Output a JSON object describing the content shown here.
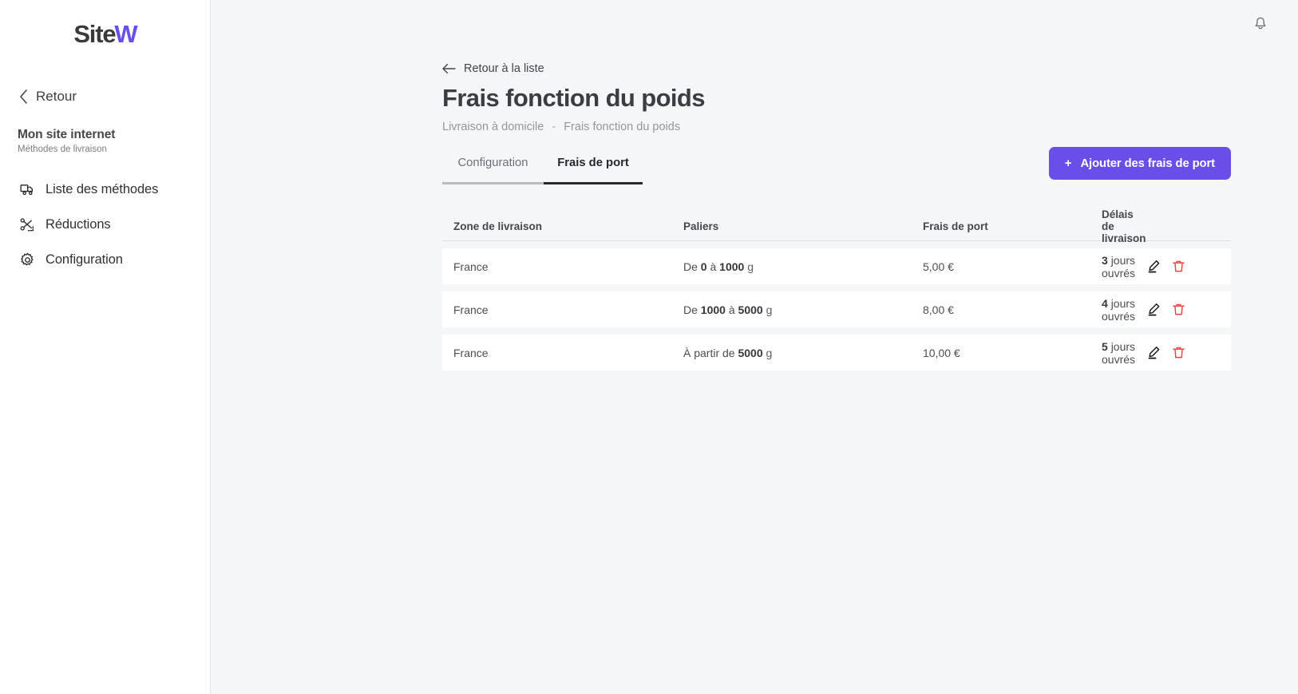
{
  "sidebar": {
    "logo": {
      "text_dark": "Site",
      "text_accent": "W"
    },
    "back": {
      "label": "Retour",
      "icon": "chevron-left-icon"
    },
    "site": {
      "title": "Mon site internet",
      "subtitle": "Méthodes de livraison"
    },
    "items": [
      {
        "label": "Liste des méthodes",
        "icon": "truck-icon"
      },
      {
        "label": "Réductions",
        "icon": "scissors-icon"
      },
      {
        "label": "Configuration",
        "icon": "gear-icon"
      }
    ]
  },
  "topbar": {
    "notification_icon": "bell-icon"
  },
  "header": {
    "back_to_list": "Retour à la liste",
    "back_icon": "arrow-left-icon",
    "title": "Frais fonction du poids",
    "breadcrumb": {
      "parent": "Livraison à domicile",
      "separator": "-",
      "current": "Frais fonction du poids"
    }
  },
  "tabs": [
    {
      "label": "Configuration",
      "active": false
    },
    {
      "label": "Frais de port",
      "active": true
    }
  ],
  "actions": {
    "add_button": {
      "plus": "+",
      "label": "Ajouter des frais de port"
    }
  },
  "table": {
    "headers": [
      "Zone de livraison",
      "Paliers",
      "Frais de port",
      "Délais de livraison"
    ],
    "row_icons": {
      "edit": "pencil-icon",
      "delete": "trash-icon"
    },
    "rows": [
      {
        "zone": "France",
        "palier_prefix": "De",
        "palier_from": "0",
        "palier_mid": "à",
        "palier_to": "1000",
        "palier_unit": "g",
        "price": "5,00 €",
        "delay_number": "3",
        "delay_text": "jours ouvrés"
      },
      {
        "zone": "France",
        "palier_prefix": "De",
        "palier_from": "1000",
        "palier_mid": "à",
        "palier_to": "5000",
        "palier_unit": "g",
        "price": "8,00 €",
        "delay_number": "4",
        "delay_text": "jours ouvrés"
      },
      {
        "zone": "France",
        "palier_prefix": "À partir de",
        "palier_from": "",
        "palier_mid": "",
        "palier_to": "5000",
        "palier_unit": "g",
        "price": "10,00 €",
        "delay_number": "5",
        "delay_text": "jours ouvrés"
      }
    ]
  },
  "colors": {
    "accent": "#6b4ee8",
    "delete": "#f03d3d",
    "page_bg": "#f5f6f8",
    "panel_bg": "#ffffff",
    "text": "#3c4043"
  }
}
